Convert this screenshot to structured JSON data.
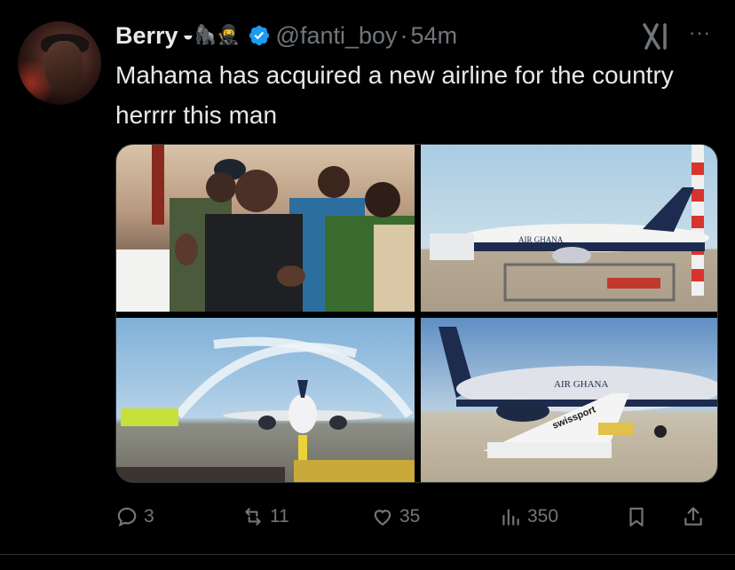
{
  "post": {
    "author_name": "Berry",
    "author_emoji": "◒🦍🥷",
    "handle": "@fanti_boy",
    "separator": "·",
    "time": "54m",
    "more": "···",
    "text": "Mahama has acquired a new airline for the country herrrr this man",
    "verified_color": "#1d9bf0",
    "airline_livery_text": "AIR GHANA",
    "stair_truck_text": "swissport"
  },
  "actions": {
    "replies": "3",
    "reposts": "11",
    "likes": "35",
    "views": "350"
  }
}
